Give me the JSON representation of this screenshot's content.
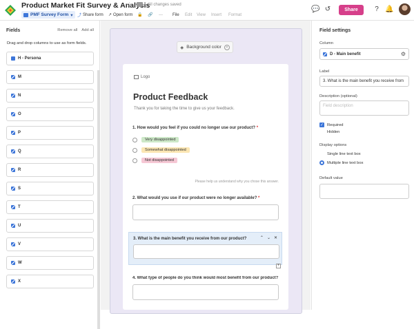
{
  "header": {
    "doc_title": "Product Market Fit Survey & Analysis",
    "saved_status": "All changes saved",
    "view_name": "PMF Survey Form",
    "toolbar": [
      "Share form",
      "Open form"
    ],
    "menu": [
      "File",
      "Edit",
      "View",
      "Insert",
      "Format"
    ],
    "share_label": "Share",
    "brand_color": "#d63f8a"
  },
  "fields_panel": {
    "title": "Fields",
    "remove_all": "Remove all",
    "add_all": "Add all",
    "hint": "Drag and drop columns to use as form fields.",
    "items": [
      "H - Persona",
      "M",
      "N",
      "O",
      "P",
      "Q",
      "R",
      "S",
      "T",
      "U",
      "V",
      "W",
      "X"
    ]
  },
  "form": {
    "background_button": "Background color",
    "logo": "Logo",
    "title": "Product Feedback",
    "subtitle": "Thank you for taking the time to give us your feedback.",
    "q1": {
      "text": "1. How would you feel if you could no longer use our product?",
      "required": "*",
      "options": [
        {
          "label": "Very disappointed",
          "color": "#cde8c8"
        },
        {
          "label": "Somewhat disappointed",
          "color": "#fbe6b3"
        },
        {
          "label": "Not disappointed",
          "color": "#f6c8d5"
        }
      ]
    },
    "help_text": "Please help us understand why you chose this answer.",
    "q2": {
      "text": "2. What would you use if our product were no longer available?",
      "required": "*"
    },
    "q3": {
      "text": "3. What is the main benefit you receive from our product?"
    },
    "q4": {
      "text": "4. What type of people do you think would most benefit from our product?"
    }
  },
  "settings": {
    "title": "Field settings",
    "column_label": "Column",
    "column_value": "D - Main benefit",
    "label_label": "Label",
    "label_value": "3. What is the main benefit you receive from",
    "desc_label": "Description (optional)",
    "desc_placeholder": "Field description",
    "required_label": "Required",
    "hidden_label": "Hidden",
    "display_title": "Display options",
    "single_line": "Single line text box",
    "multi_line": "Multiple line text box",
    "default_label": "Default value"
  }
}
